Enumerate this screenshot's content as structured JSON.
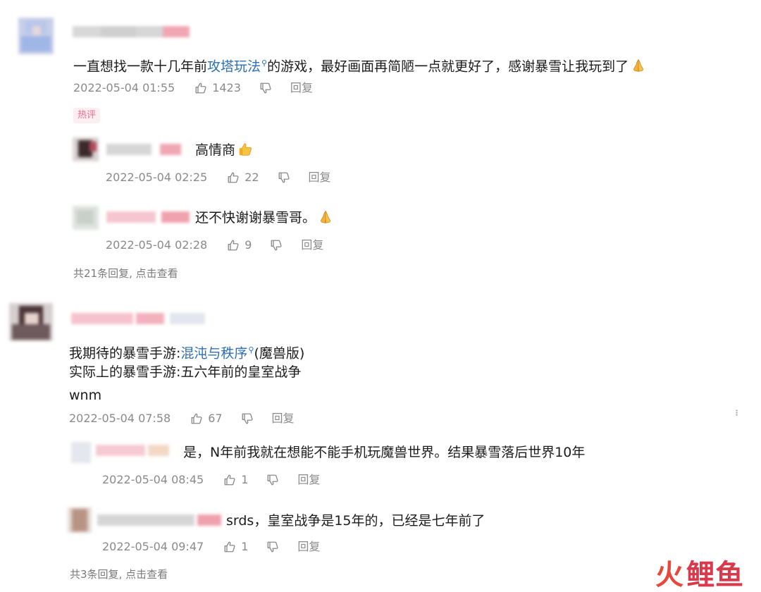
{
  "colors": {
    "link": "#2f6fb3",
    "meta": "#8a8a8a",
    "hot_badge_text": "#f26b8a",
    "watermark": "#e8473c"
  },
  "icons": {
    "like": "thumbs-up-icon",
    "dislike": "thumbs-down-icon",
    "search": "search-icon",
    "more": "more-vertical-icon"
  },
  "comments": [
    {
      "text_before_link": "一直想找一款十几年前",
      "link": "攻塔玩法",
      "text_after_link": "的游戏，最好画面再简陋一点就更好了，感谢暴雪让我玩到了",
      "timestamp": "2022-05-04 01:55",
      "likes": "1423",
      "reply_label": "回复",
      "badge": "热评",
      "replies": [
        {
          "text": "高情商",
          "timestamp": "2022-05-04 02:25",
          "likes": "22",
          "reply_label": "回复"
        },
        {
          "text": "还不快谢谢暴雪哥。",
          "timestamp": "2022-05-04 02:28",
          "likes": "9",
          "reply_label": "回复"
        }
      ],
      "view_more": "共21条回复, 点击查看"
    },
    {
      "line1_before_link": "我期待的暴雪手游:",
      "link": "混沌与秩序",
      "line1_after_link": "(魔兽版)",
      "line2": "实际上的暴雪手游:五六年前的皇室战争",
      "line3": "wnm",
      "timestamp": "2022-05-04 07:58",
      "likes": "67",
      "reply_label": "回复",
      "more_label": "···",
      "replies": [
        {
          "text": "是，N年前我就在想能不能手机玩魔兽世界。结果暴雪落后世界10年",
          "timestamp": "2022-05-04 08:45",
          "likes": "1",
          "reply_label": "回复"
        },
        {
          "text": "srds，皇室战争是15年的，已经是七年前了",
          "timestamp": "2022-05-04 09:47",
          "likes": "1",
          "reply_label": "回复"
        }
      ],
      "view_more": "共3条回复, 点击查看"
    }
  ],
  "watermark": {
    "fire": "火",
    "rest": "鲤鱼"
  }
}
